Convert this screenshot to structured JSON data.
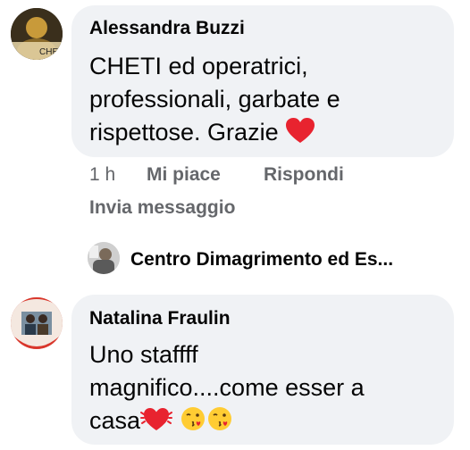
{
  "comments": [
    {
      "author": "Alessandra Buzzi",
      "text": "CHETI ed operatrici, professionali, garbate e rispettose. Grazie",
      "text_lines": [
        "CHETI ed operatrici,",
        "professionali, garbate e",
        "rispettose. Grazie"
      ],
      "emoji": [
        "red-heart"
      ],
      "avatar_caption": "CHE",
      "time": "1 h",
      "like_label": "Mi piace",
      "reply_label": "Rispondi",
      "message_label": "Invia messaggio"
    },
    {
      "author": "Natalina Fraulin",
      "text_lines": [
        "Uno staffff",
        "magnifico....come esser a",
        "casa"
      ],
      "emoji": [
        "beating-heart",
        "face-blowing-kiss",
        "face-blowing-kiss"
      ]
    }
  ],
  "reply_preview": {
    "author": "Centro Dimagrimento ed Es..."
  },
  "colors": {
    "bubble": "#f0f2f5",
    "meta": "#65676b",
    "text": "#050505",
    "heart": "#e8232f",
    "emoji_face": "#ffcc33"
  }
}
